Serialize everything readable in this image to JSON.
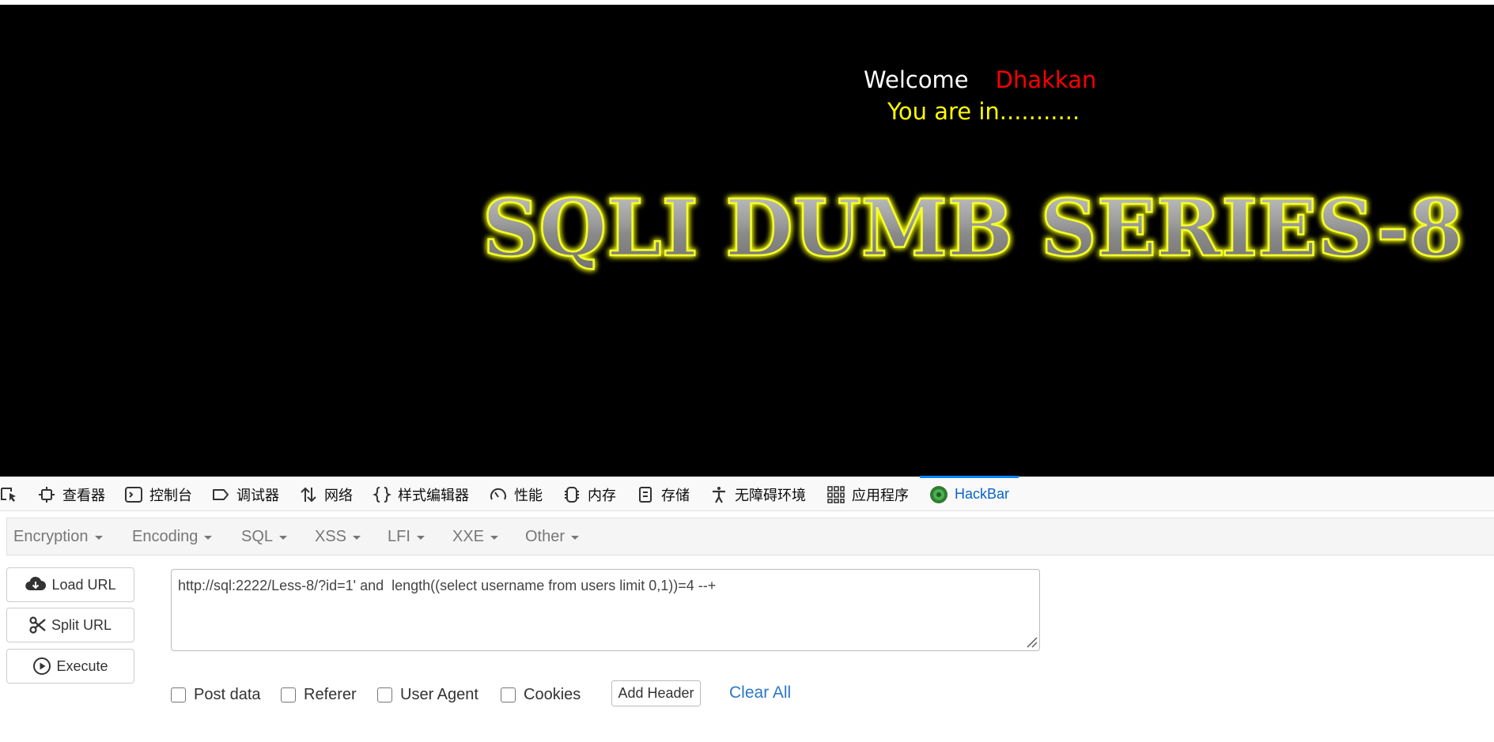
{
  "page": {
    "welcome_label": "Welcome",
    "welcome_name": "Dhakkan",
    "status_text": "You are in...........",
    "banner_title": "SQLI DUMB SERIES-8"
  },
  "devtools": {
    "tabs": [
      {
        "label": "查看器",
        "icon": "inspector-icon"
      },
      {
        "label": "控制台",
        "icon": "console-icon"
      },
      {
        "label": "调试器",
        "icon": "debugger-icon"
      },
      {
        "label": "网络",
        "icon": "network-icon"
      },
      {
        "label": "样式编辑器",
        "icon": "style-editor-icon"
      },
      {
        "label": "性能",
        "icon": "performance-icon"
      },
      {
        "label": "内存",
        "icon": "memory-icon"
      },
      {
        "label": "存储",
        "icon": "storage-icon"
      },
      {
        "label": "无障碍环境",
        "icon": "accessibility-icon"
      },
      {
        "label": "应用程序",
        "icon": "application-icon"
      },
      {
        "label": "HackBar",
        "icon": "hackbar-icon",
        "active": true
      }
    ]
  },
  "hackbar": {
    "menu": [
      "Encryption",
      "Encoding",
      "SQL",
      "XSS",
      "LFI",
      "XXE",
      "Other"
    ],
    "buttons": {
      "load_url": "Load URL",
      "split_url": "Split URL",
      "execute": "Execute"
    },
    "url_value": "http://sql:2222/Less-8/?id=1' and  length((select username from users limit 0,1))=4 --+",
    "options": {
      "post_data": "Post data",
      "referer": "Referer",
      "user_agent": "User Agent",
      "cookies": "Cookies"
    },
    "add_header": "Add Header",
    "clear_all": "Clear All"
  },
  "colors": {
    "welcome_name": "#ff0000",
    "status_text": "#ffff00",
    "active_tab": "#0a64c8",
    "link": "#2a77c9"
  }
}
